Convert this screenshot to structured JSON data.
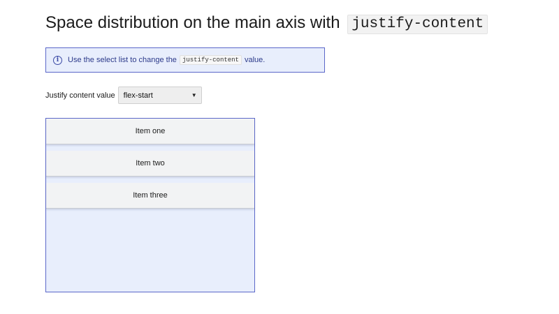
{
  "heading": {
    "text": "Space distribution on the main axis with",
    "code": "justify-content"
  },
  "note": {
    "icon": "info-icon",
    "prefix": "Use the select list to change the",
    "code": "justify-content",
    "suffix": "value."
  },
  "control": {
    "label": "Justify content value",
    "selected": "flex-start"
  },
  "items": [
    "Item one",
    "Item two",
    "Item three"
  ],
  "colors": {
    "note_bg": "#e8eefc",
    "border": "#5b67c9",
    "item_bg": "#f2f3f4"
  }
}
